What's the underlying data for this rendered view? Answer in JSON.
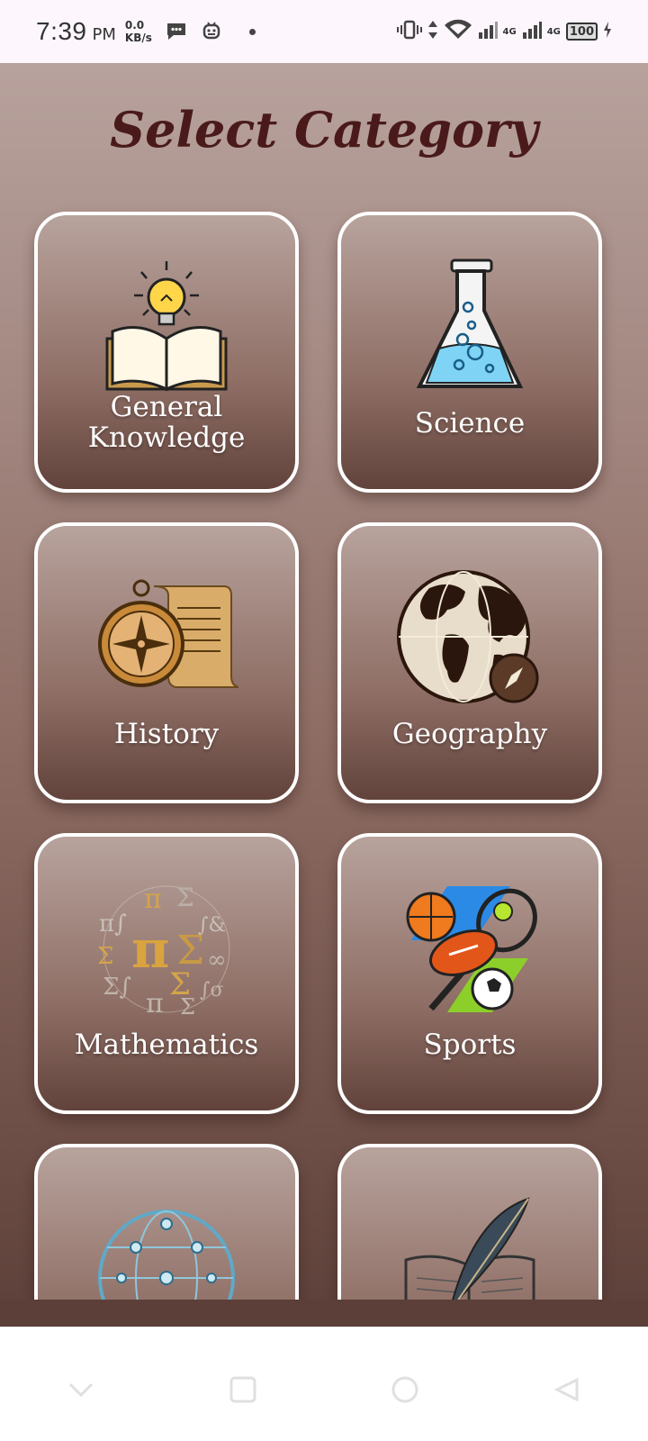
{
  "status_bar": {
    "time": "7:39",
    "ampm": "PM",
    "net_speed_value": "0.0",
    "net_speed_unit": "KB/s",
    "network_label_1": "4G",
    "network_label_2": "4G",
    "battery": "100"
  },
  "screen": {
    "title": "Select Category"
  },
  "categories": [
    {
      "label": "General Knowledge",
      "icon": "book-lightbulb-icon"
    },
    {
      "label": "Science",
      "icon": "flask-icon"
    },
    {
      "label": "History",
      "icon": "compass-scroll-icon"
    },
    {
      "label": "Geography",
      "icon": "globe-icon"
    },
    {
      "label": "Mathematics",
      "icon": "math-symbols-icon"
    },
    {
      "label": "Sports",
      "icon": "sports-balls-icon"
    },
    {
      "label": "",
      "icon": "network-globe-icon"
    },
    {
      "label": "",
      "icon": "book-quill-icon"
    }
  ],
  "nav": {
    "back": "back-icon",
    "home": "home-icon",
    "recents": "recents-icon"
  }
}
